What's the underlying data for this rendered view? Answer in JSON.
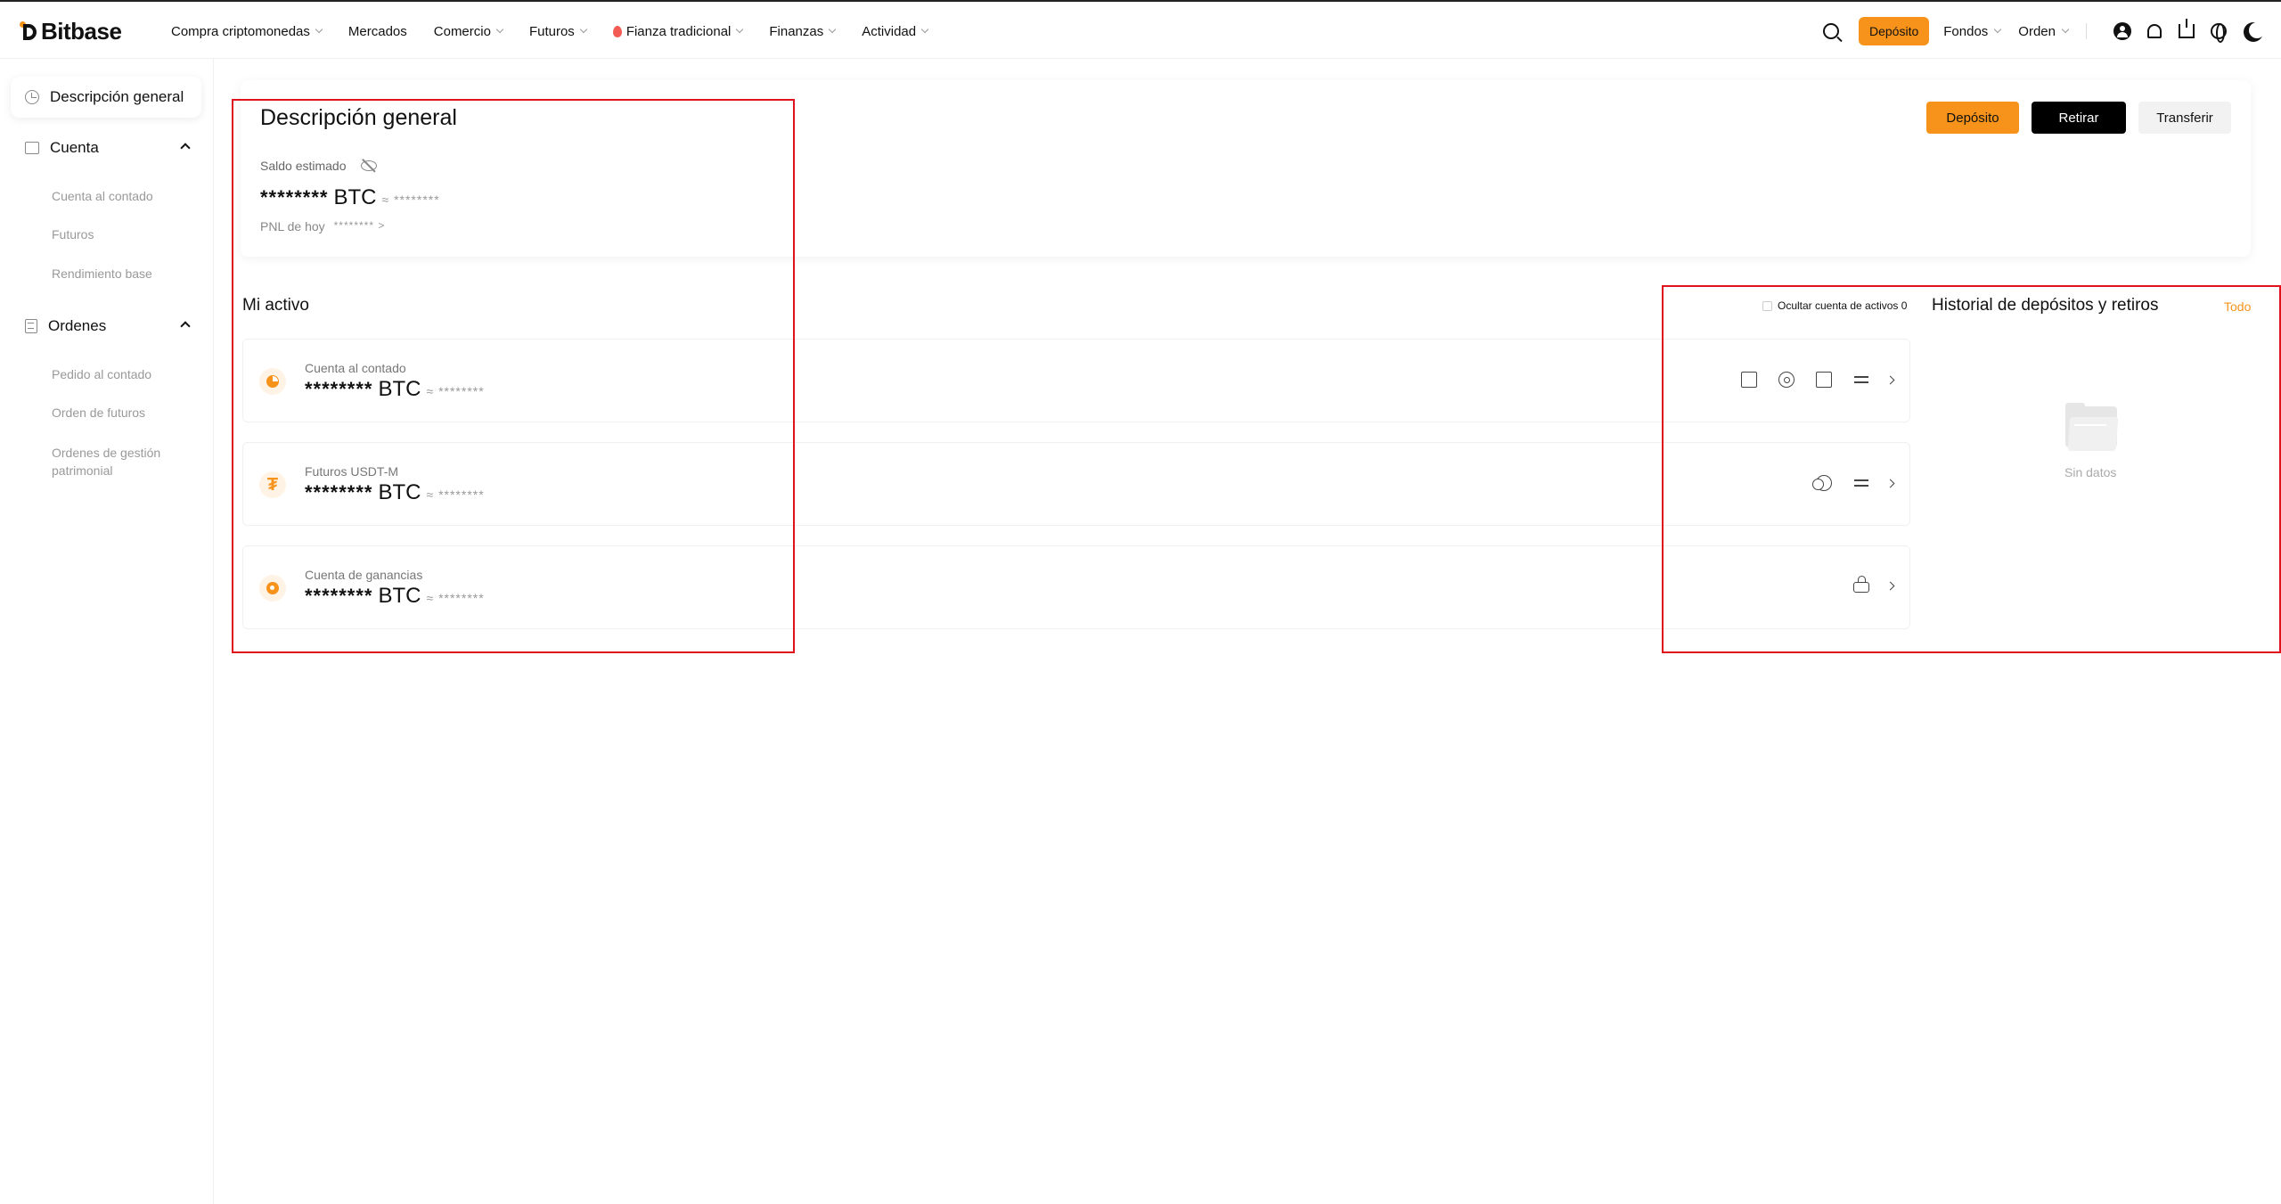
{
  "brand": {
    "name": "Bitbase"
  },
  "nav": {
    "items": [
      {
        "label": "Compra criptomonedas",
        "dropdown": true
      },
      {
        "label": "Mercados",
        "dropdown": false
      },
      {
        "label": "Comercio",
        "dropdown": true
      },
      {
        "label": "Futuros",
        "dropdown": true
      },
      {
        "label": "Fianza tradicional",
        "dropdown": true,
        "hot": true
      },
      {
        "label": "Finanzas",
        "dropdown": true
      },
      {
        "label": "Actividad",
        "dropdown": true
      }
    ],
    "deposit": "Depósito",
    "funds": "Fondos",
    "order": "Orden"
  },
  "sidebar": {
    "active": "Descripción general",
    "groups": [
      {
        "label": "Cuenta",
        "items": [
          "Cuenta al contado",
          "Futuros",
          "Rendimiento base"
        ]
      },
      {
        "label": "Ordenes",
        "items": [
          "Pedido al contado",
          "Orden de futuros",
          "Ordenes de gestión patrimonial"
        ]
      }
    ]
  },
  "overview": {
    "title": "Descripción general",
    "balance_label": "Saldo estimado",
    "balance_masked": "********",
    "currency": "BTC",
    "approx": "≈ ********",
    "pnl_label": "PNL de hoy",
    "pnl_value": "******** >",
    "buttons": {
      "deposit": "Depósito",
      "withdraw": "Retirar",
      "transfer": "Transferir"
    }
  },
  "assets": {
    "title": "Mi activo",
    "hide_label": "Ocultar cuenta de activos 0",
    "accounts": [
      {
        "name": "Cuenta al contado",
        "balance": "********",
        "currency": "BTC",
        "approx": "≈ ********",
        "icon": "pie-chart-icon"
      },
      {
        "name": "Futuros USDT-M",
        "balance": "********",
        "currency": "BTC",
        "approx": "≈ ********",
        "icon": "tether-icon"
      },
      {
        "name": "Cuenta de ganancias",
        "balance": "********",
        "currency": "BTC",
        "approx": "≈ ********",
        "icon": "earn-icon"
      }
    ]
  },
  "history": {
    "title": "Historial de depósitos y retiros",
    "all": "Todo",
    "empty": "Sin datos"
  },
  "colors": {
    "accent": "#f7931a",
    "annotation": "#e0131c"
  }
}
